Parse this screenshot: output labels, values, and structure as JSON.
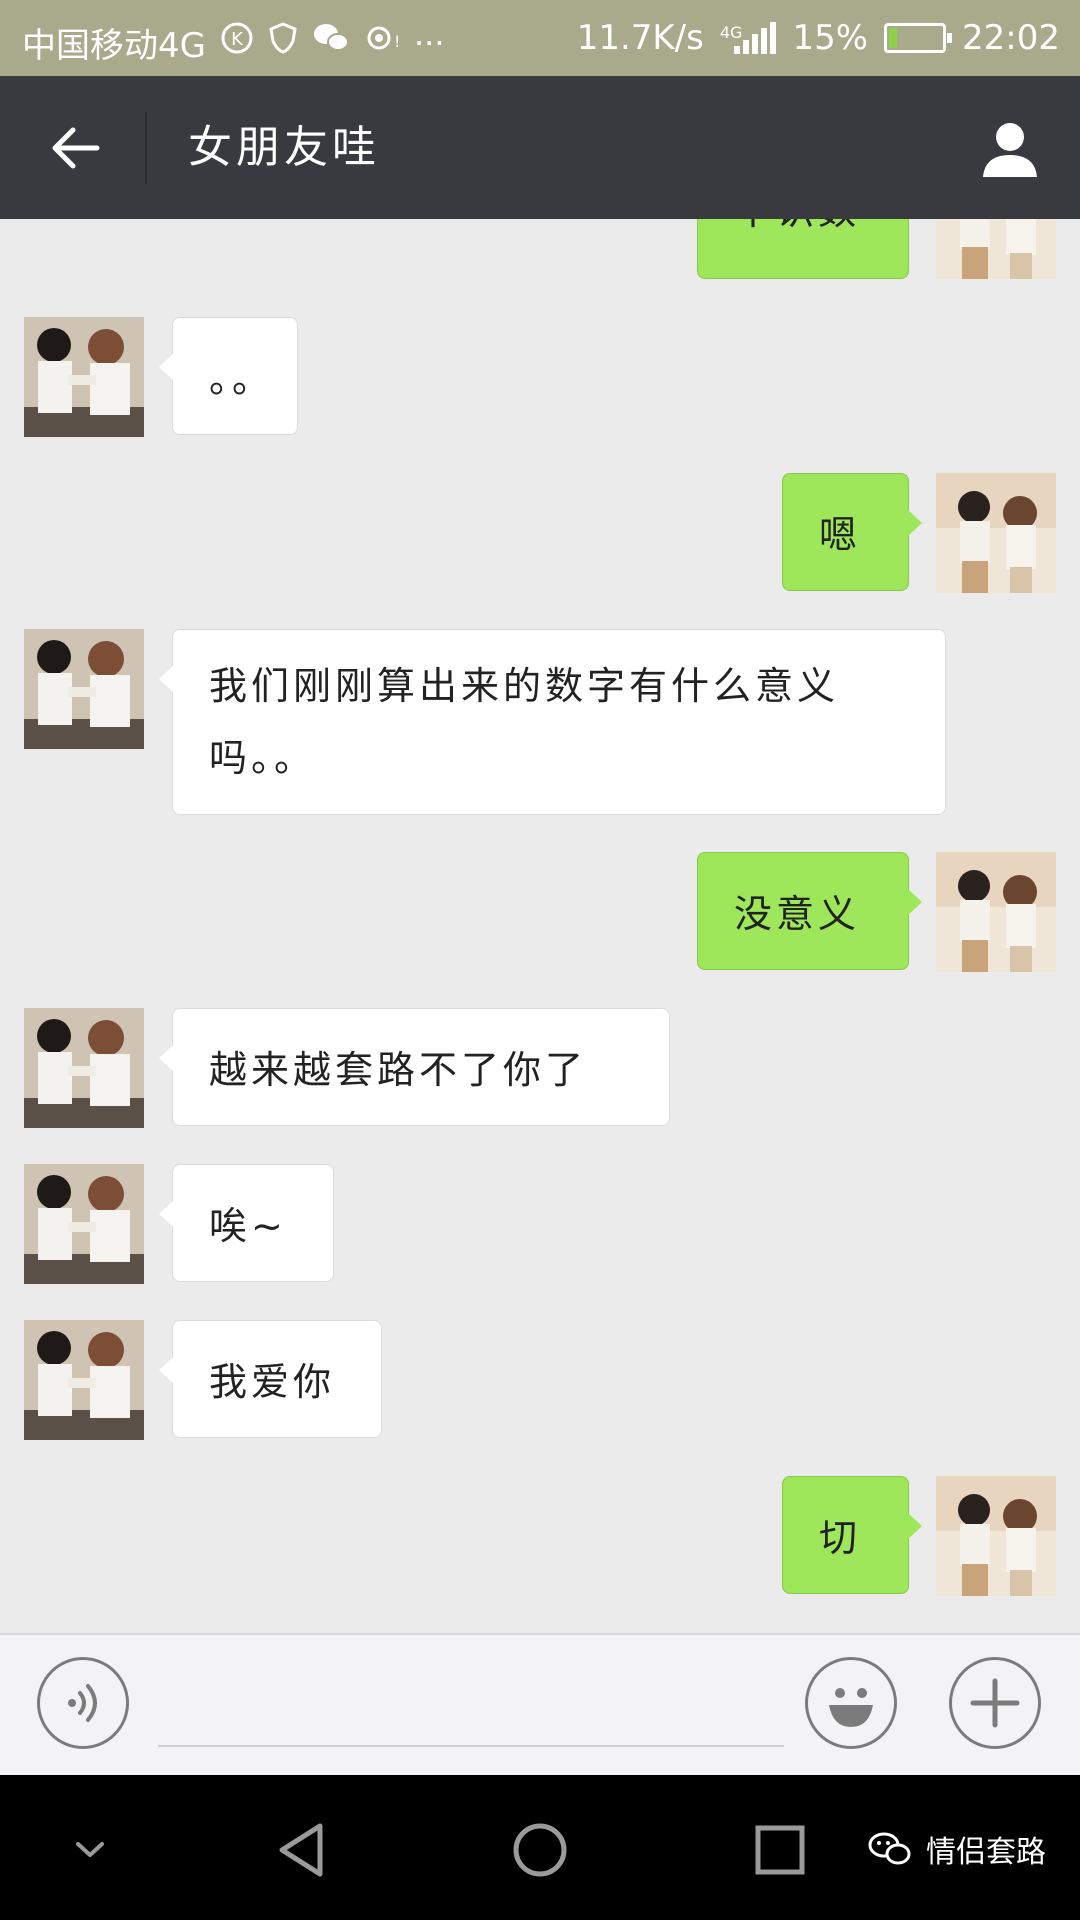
{
  "status_bar": {
    "carrier": "中国移动4G",
    "speed": "11.7K/s",
    "network_type": "4G",
    "battery_percent": "15%",
    "battery_level": 0.15,
    "time": "22:02",
    "icons": [
      "k-icon",
      "shield-icon",
      "wechat-icon",
      "hotspot-icon",
      "more-icon",
      "signal-icon",
      "battery-charging-icon"
    ]
  },
  "header": {
    "title": "女朋友哇",
    "back_icon": "arrow-left-icon",
    "profile_icon": "person-icon",
    "bg_color": "#393a3f"
  },
  "messages": [
    {
      "from": "me",
      "text": "不识数"
    },
    {
      "from": "her",
      "text": "。。"
    },
    {
      "from": "me",
      "text": "嗯"
    },
    {
      "from": "her",
      "text": "我们刚刚算出来的数字有什么意义吗。。"
    },
    {
      "from": "me",
      "text": "没意义"
    },
    {
      "from": "her",
      "text": "越来越套路不了你了"
    },
    {
      "from": "her",
      "text": "唉~"
    },
    {
      "from": "her",
      "text": "我爱你"
    },
    {
      "from": "me",
      "text": "切"
    }
  ],
  "colors": {
    "outgoing_bubble": "#9ee65a",
    "incoming_bubble": "#ffffff",
    "chat_background": "#ebebeb"
  },
  "input_bar": {
    "voice_icon": "voice-icon",
    "emoji_icon": "smiley-icon",
    "plus_icon": "plus-icon",
    "placeholder": ""
  },
  "nav_bar": {
    "icons": [
      "chevron-down-icon",
      "back-triangle-icon",
      "home-circle-icon",
      "recents-square-icon"
    ]
  },
  "watermark": {
    "text": "情侣套路"
  }
}
